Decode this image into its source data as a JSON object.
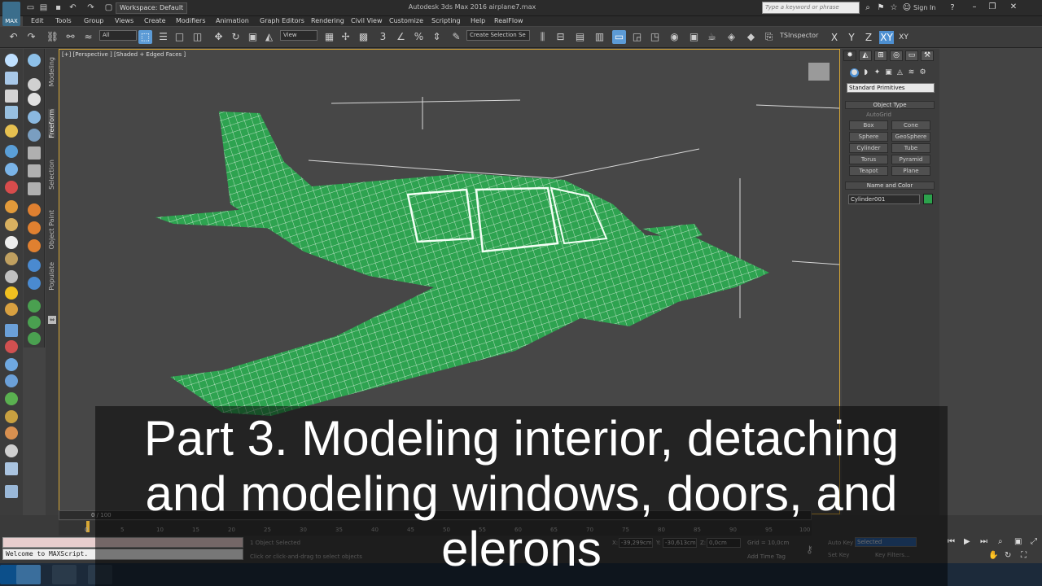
{
  "titlebar": {
    "workspace": "Workspace: Default",
    "app_title": "Autodesk 3ds Max 2016    airplane7.max",
    "search_placeholder": "Type a keyword or phrase",
    "sign_in": "Sign In",
    "app_icon_label": "MAX"
  },
  "menu": [
    "Edit",
    "Tools",
    "Group",
    "Views",
    "Create",
    "Modifiers",
    "Animation",
    "Graph Editors",
    "Rendering",
    "Civil View",
    "Customize",
    "Scripting",
    "Help",
    "RealFlow"
  ],
  "toolbar": {
    "filter_dropdown": "All",
    "ref_coord_dropdown": "View",
    "named_selection": "Create Selection Se",
    "tsinspector": "TSInspector",
    "axis_buttons": [
      "X",
      "Y",
      "Z",
      "XY",
      "XY"
    ]
  },
  "ribbon_tabs": [
    "Modeling",
    "Freeform",
    "Selection",
    "Object Paint",
    "Populate"
  ],
  "viewport": {
    "label": "[+] [Perspective ] [Shaded + Edged Faces ]",
    "accent_color": "#d8a734",
    "model_color": "#2ea350"
  },
  "command_panel": {
    "primitive_type": "Standard Primitives",
    "object_type_title": "Object Type",
    "autogrid": "AutoGrid",
    "buttons": [
      "Box",
      "Cone",
      "Sphere",
      "GeoSphere",
      "Cylinder",
      "Tube",
      "Torus",
      "Pyramid",
      "Teapot",
      "Plane"
    ],
    "name_color_title": "Name and Color",
    "object_name": "Cylinder001",
    "object_color": "#2ca24c"
  },
  "timeline": {
    "frame_label": "0 / 100",
    "ticks": [
      "0",
      "5",
      "10",
      "15",
      "20",
      "25",
      "30",
      "35",
      "40",
      "45",
      "50",
      "55",
      "60",
      "65",
      "70",
      "75",
      "80",
      "85",
      "90",
      "95",
      "100"
    ]
  },
  "status": {
    "maxscript_output": "Welcome to MAXScript.",
    "selection": "1 Object Selected",
    "prompt": "Click or click-and-drag to select objects",
    "x_label": "X:",
    "x_value": "-39,299cm",
    "y_label": "Y:",
    "y_value": "-30,613cm",
    "z_label": "Z:",
    "z_value": "0,0cm",
    "grid": "Grid = 10,0cm",
    "add_time_tag": "Add Time Tag",
    "auto_key": "Auto Key",
    "set_key": "Set Key",
    "selected_dropdown": "Selected",
    "key_filters": "Key Filters..."
  },
  "caption": {
    "line1": "Part 3. Modeling interior, detaching",
    "line2": "and modeling windows, doors,  and",
    "line3": "elerons"
  }
}
